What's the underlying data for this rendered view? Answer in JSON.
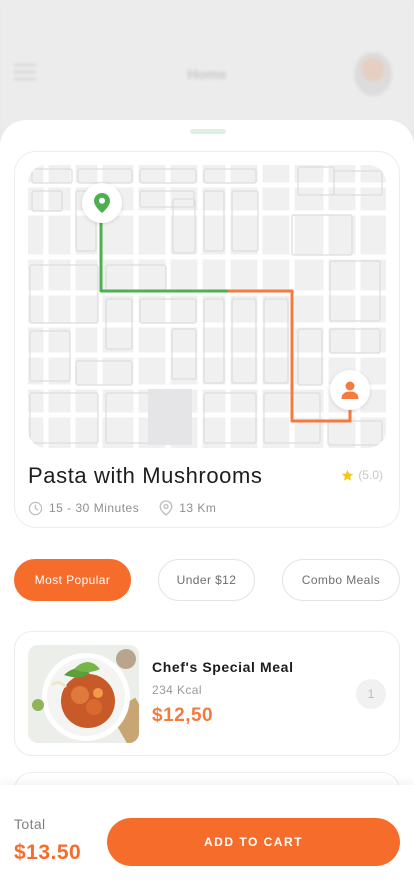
{
  "background": {
    "title": "Home"
  },
  "restaurant": {
    "dish_title": "Pasta with Mushrooms",
    "rating": "(5.0)",
    "time": "15 - 30 Minutes",
    "distance": "13 Km"
  },
  "filters": [
    {
      "label": "Most Popular",
      "active": true
    },
    {
      "label": "Under $12",
      "active": false
    },
    {
      "label": "Combo Meals",
      "active": false
    }
  ],
  "meal": {
    "name": "Chef's Special Meal",
    "kcal": "234 Kcal",
    "price": "$12,50",
    "quantity": "1"
  },
  "footer": {
    "total_label": "Total",
    "total_value": "$13.50",
    "cart_button": "ADD TO CART"
  },
  "colors": {
    "accent": "#f66d2b",
    "route_green": "#4caf50",
    "route_orange": "#f47a3d",
    "star": "#f5c518"
  },
  "icons": {
    "restaurant_marker": "map-pin-icon",
    "destination_marker": "person-icon",
    "time": "clock-icon",
    "distance": "location-icon",
    "rating": "star-icon"
  }
}
